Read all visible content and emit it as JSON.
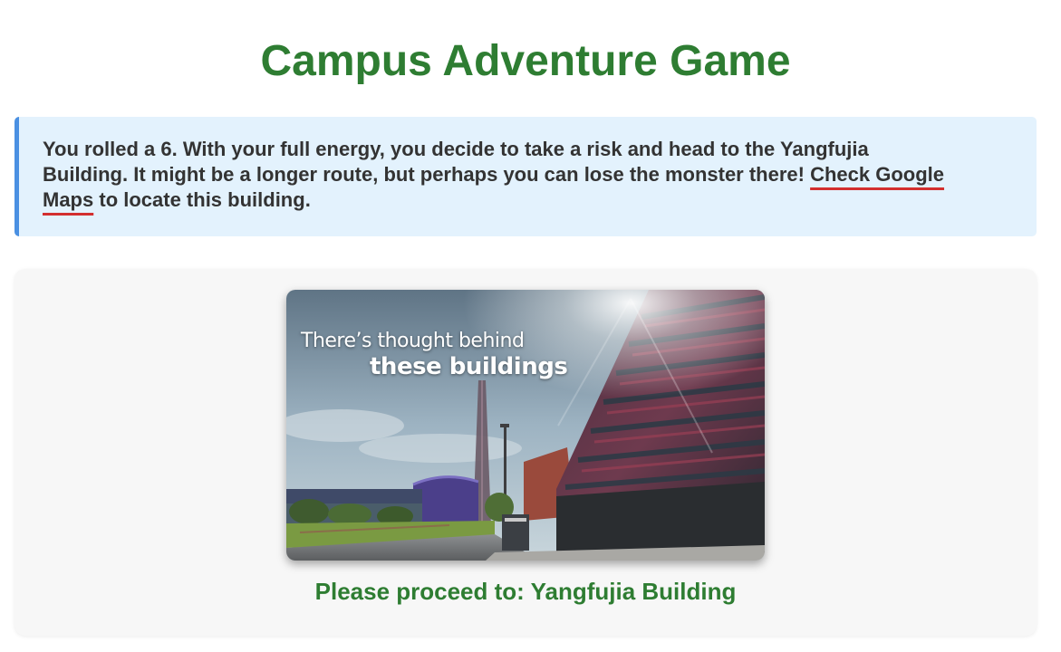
{
  "header": {
    "title": "Campus Adventure Game"
  },
  "story": {
    "text_before_link": "You rolled a 6. With your full energy, you decide to take a risk and head to the Yangfujia Building. It might be a longer route, but perhaps you can lose the monster there!",
    "link_text": "Check Google Maps",
    "text_after_link": " to locate this building."
  },
  "location_card": {
    "image_caption_line1": "There’s thought behind",
    "image_caption_line2": "these buildings",
    "proceed_text": "Please proceed to: Yangfujia Building"
  },
  "colors": {
    "title_green": "#2e7d32",
    "story_background": "#e3f2fd",
    "story_border": "#4a90e2",
    "link_underline": "#d32f2f",
    "card_background": "#f7f7f7"
  }
}
